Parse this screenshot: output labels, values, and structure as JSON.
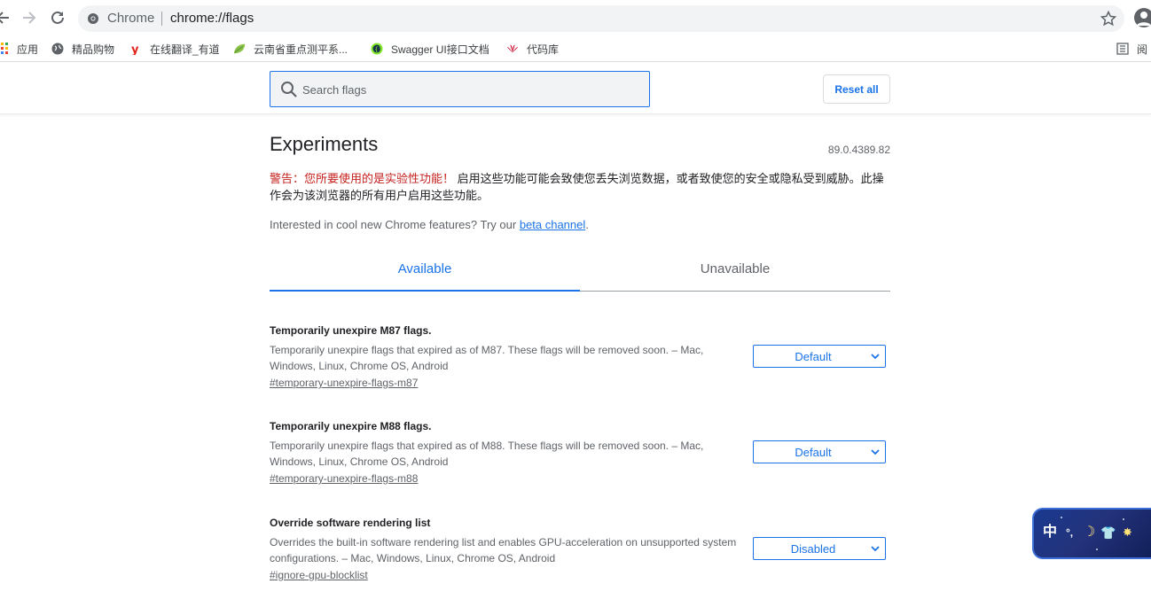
{
  "toolbar": {
    "site_label": "Chrome",
    "url": "chrome://flags"
  },
  "bookmarks": [
    {
      "label": "应用",
      "icon": "apps-grid-icon"
    },
    {
      "label": "精品购物",
      "icon": "globe-icon"
    },
    {
      "label": "在线翻译_有道",
      "icon": "youdao-icon"
    },
    {
      "label": "云南省重点测平系...",
      "icon": "leaf-icon"
    },
    {
      "label": "Swagger UI接口文档",
      "icon": "swagger-icon"
    },
    {
      "label": "代码库",
      "icon": "huawei-icon"
    }
  ],
  "bookmarks_overflow": {
    "label": "阅",
    "icon": "reading-list-icon"
  },
  "search": {
    "placeholder": "Search flags"
  },
  "reset_label": "Reset all",
  "page": {
    "title": "Experiments",
    "version": "89.0.4389.82",
    "warning_strong": "警告：您所要使用的是实验性功能！",
    "warning_text": " 启用这些功能可能会致使您丢失浏览数据，或者致使您的安全或隐私受到威胁。此操作会为该浏览器的所有用户启用这些功能。",
    "interest_text": "Interested in cool new Chrome features? Try our ",
    "interest_link": "beta channel",
    "interest_end": "."
  },
  "tabs": [
    {
      "label": "Available",
      "active": true
    },
    {
      "label": "Unavailable",
      "active": false
    }
  ],
  "flags": [
    {
      "title": "Temporarily unexpire M87 flags.",
      "description": "Temporarily unexpire flags that expired as of M87. These flags will be removed soon. – Mac, Windows, Linux, Chrome OS, Android",
      "link": "#temporary-unexpire-flags-m87",
      "value": "Default"
    },
    {
      "title": "Temporarily unexpire M88 flags.",
      "description": "Temporarily unexpire flags that expired as of M88. These flags will be removed soon. – Mac, Windows, Linux, Chrome OS, Android",
      "link": "#temporary-unexpire-flags-m88",
      "value": "Default"
    },
    {
      "title": "Override software rendering list",
      "description": "Overrides the built-in software rendering list and enables GPU-acceleration on unsupported system configurations. – Mac, Windows, Linux, Chrome OS, Android",
      "link": "#ignore-gpu-blocklist",
      "value": "Disabled"
    }
  ],
  "ime": {
    "mode": "中",
    "punct": "°,",
    "moon": "☽",
    "skin": "👕",
    "settings": "✸"
  },
  "colors": {
    "accent": "#1a73e8",
    "warning": "#c5221f",
    "ime_bg": "#23327a"
  }
}
